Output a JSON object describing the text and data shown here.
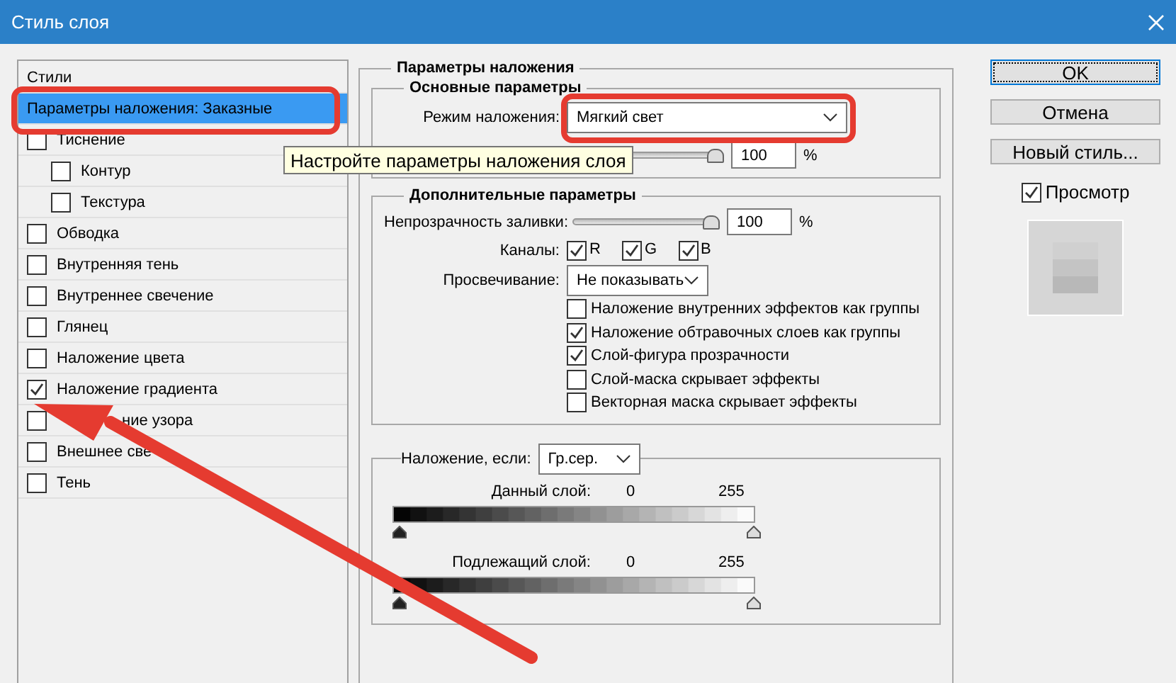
{
  "window": {
    "title": "Стиль слоя"
  },
  "styles_panel": {
    "heading": "Стили",
    "items": [
      {
        "label": "Параметры наложения: Заказные",
        "kind": "link",
        "selected": true
      },
      {
        "label": "Тиснение",
        "kind": "checkbox",
        "checked": false,
        "selected": false,
        "children": [
          {
            "label": "Контур",
            "kind": "checkbox",
            "checked": false,
            "selected": false
          },
          {
            "label": "Текстура",
            "kind": "checkbox",
            "checked": false,
            "selected": false
          }
        ]
      },
      {
        "label": "Обводка",
        "kind": "checkbox",
        "checked": false,
        "selected": false
      },
      {
        "label": "Внутренняя тень",
        "kind": "checkbox",
        "checked": false,
        "selected": false
      },
      {
        "label": "Внутреннее свечение",
        "kind": "checkbox",
        "checked": false,
        "selected": false
      },
      {
        "label": "Глянец",
        "kind": "checkbox",
        "checked": false,
        "selected": false
      },
      {
        "label": "Наложение цвета",
        "kind": "checkbox",
        "checked": false,
        "selected": false
      },
      {
        "label": "Наложение градиента",
        "kind": "checkbox",
        "checked": true,
        "selected": false
      },
      {
        "label": "ние узора",
        "kind": "covered",
        "checked": false,
        "selected": false
      },
      {
        "label": "Внешнее све",
        "kind": "checkbox",
        "checked": false,
        "selected": false
      },
      {
        "label": "Тень",
        "kind": "checkbox",
        "checked": false,
        "selected": false
      }
    ]
  },
  "blending_options": {
    "title": "Параметры наложения",
    "general": {
      "title": "Основные параметры",
      "blend_mode": {
        "label": "Режим наложения:",
        "value": "Мягкий свет"
      },
      "opacity": {
        "level": 1,
        "value": "100",
        "unit": "%"
      }
    },
    "advanced": {
      "title": "Дополнительные параметры",
      "fill_opacity": {
        "label": "Непрозрачность заливки:",
        "level": 1,
        "value": "100",
        "unit": "%"
      },
      "channels": {
        "label": "Каналы:",
        "items": [
          {
            "label": "R",
            "checked": true
          },
          {
            "label": "G",
            "checked": true
          },
          {
            "label": "B",
            "checked": true
          }
        ]
      },
      "knockout": {
        "label": "Просвечивание:",
        "value": "Не показывать"
      },
      "options": [
        {
          "label": "Наложение внутренних эффектов как группы",
          "checked": false
        },
        {
          "label": "Наложение обтравочных слоев как группы",
          "checked": true
        },
        {
          "label": "Слой-фигура прозрачности",
          "checked": true
        },
        {
          "label": "Слой-маска скрывает эффекты",
          "checked": false
        },
        {
          "label": "Векторная маска скрывает эффекты",
          "checked": false
        }
      ]
    },
    "blend_if": {
      "label": "Наложение, если:",
      "value": "Гр.сер.",
      "layers": [
        {
          "label": "Данный слой:",
          "low": "0",
          "high": "255"
        },
        {
          "label": "Подлежащий слой:",
          "low": "0",
          "high": "255"
        }
      ]
    }
  },
  "buttons": [
    {
      "label": "OK",
      "focused": true
    },
    {
      "label": "Отмена",
      "focused": false
    },
    {
      "label": "Новый стиль...",
      "focused": false
    }
  ],
  "preview": {
    "label": "Просмотр",
    "checked": true
  },
  "tooltip": {
    "text": "Настройте параметры наложения слоя"
  }
}
